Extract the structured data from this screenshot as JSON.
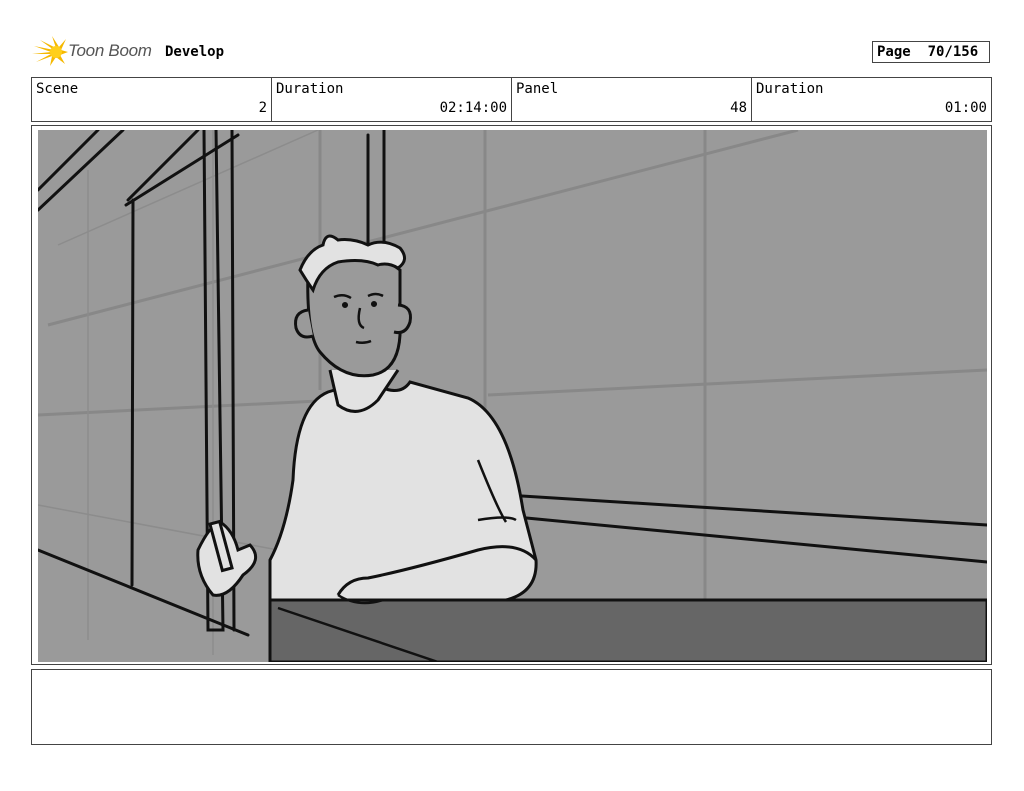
{
  "header": {
    "logo_text": "Toon Boom",
    "project_name": "Develop",
    "page_label": "Page",
    "page_value": "70/156"
  },
  "info": {
    "scene_label": "Scene",
    "scene_value": "2",
    "scene_duration_label": "Duration",
    "scene_duration_value": "02:14:00",
    "panel_label": "Panel",
    "panel_value": "48",
    "panel_duration_label": "Duration",
    "panel_duration_value": "01:00"
  },
  "notes": {
    "text": ""
  },
  "colors": {
    "background_gray": "#9a9a9a",
    "shirt": "#e2e2e2",
    "desk": "#666666",
    "logo_yellow": "#f5b800"
  }
}
